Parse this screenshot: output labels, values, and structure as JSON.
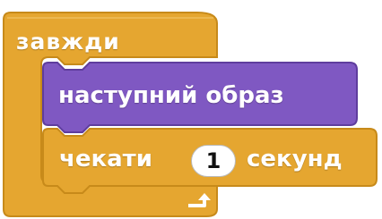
{
  "blocks": {
    "forever": {
      "label": "завжди",
      "color": "#E5A630"
    },
    "next_costume": {
      "label": "наступний образ",
      "color": "#7F58C2"
    },
    "wait": {
      "label_before": "чекати",
      "input_value": "1",
      "label_after": "секунд",
      "color": "#E5A630"
    },
    "loop_arrow_icon": "loop-arrow-icon"
  }
}
